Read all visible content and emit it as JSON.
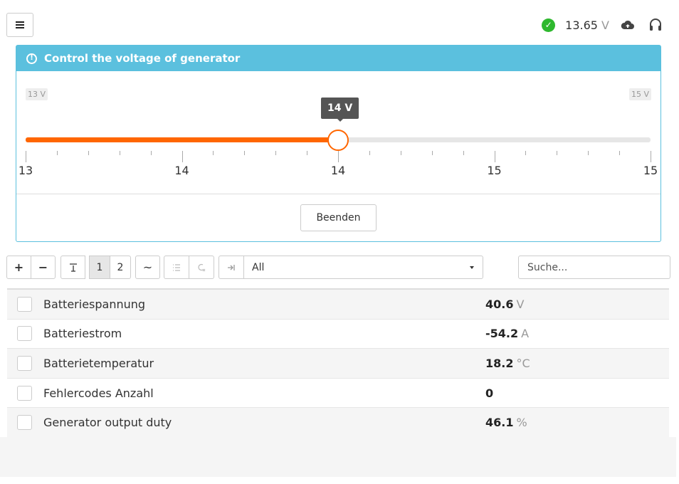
{
  "header": {
    "voltage_value": "13.65",
    "voltage_unit": "V",
    "status_color": "#2eb82e"
  },
  "panel": {
    "title": "Control the voltage of generator",
    "slider": {
      "min_label": "13 V",
      "max_label": "15 V",
      "current_label": "14 V",
      "min": 13,
      "max": 15,
      "value": 14,
      "tick_labels": [
        "13",
        "14",
        "14",
        "15",
        "15"
      ],
      "accent_color": "#ff6600"
    },
    "end_button_label": "Beenden"
  },
  "toolbar": {
    "add_label": "+",
    "remove_label": "−",
    "page1_label": "1",
    "page2_label": "2",
    "wave_label": "~",
    "filter_value": "All",
    "search_placeholder": "Suche..."
  },
  "table": {
    "rows": [
      {
        "name": "Batteriespannung",
        "value": "40.6",
        "unit": "V"
      },
      {
        "name": "Batteriestrom",
        "value": "-54.2",
        "unit": "A"
      },
      {
        "name": "Batterietemperatur",
        "value": "18.2",
        "unit": "°C"
      },
      {
        "name": "Fehlercodes Anzahl",
        "value": "0",
        "unit": ""
      },
      {
        "name": "Generator output duty",
        "value": "46.1",
        "unit": "%"
      }
    ]
  }
}
